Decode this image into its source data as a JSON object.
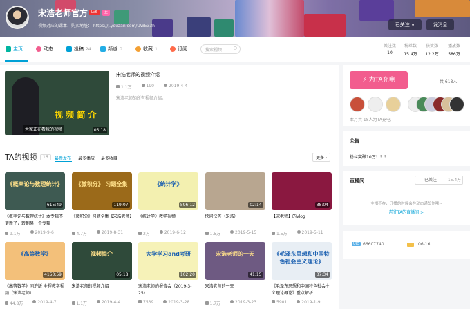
{
  "header": {
    "username": "宋浩老师官方",
    "level": "LV6",
    "badge": "年",
    "sign": "视频对应的课本、购买地址： https://j.youzan.com/UWE33h",
    "follow_btn": "已关注",
    "message_btn": "发消息"
  },
  "nav": {
    "items": [
      {
        "label": "主页",
        "count": ""
      },
      {
        "label": "动态",
        "count": ""
      },
      {
        "label": "投稿",
        "count": "24"
      },
      {
        "label": "频道",
        "count": "0"
      },
      {
        "label": "收藏",
        "count": "1"
      },
      {
        "label": "订阅",
        "count": ""
      }
    ],
    "search_placeholder": "搜索视频"
  },
  "stats": [
    {
      "label": "关注数",
      "value": "10"
    },
    {
      "label": "粉丝数",
      "value": "15.4万"
    },
    {
      "label": "获赞数",
      "value": "12.2万"
    },
    {
      "label": "播放数",
      "value": "586万"
    }
  ],
  "featured": {
    "title": "宋浩老师的视频介绍",
    "plays": "1.1万",
    "danmaku": "190",
    "date": "2019-4-4",
    "desc": "宋浩老师的所有视频介绍。",
    "duration": "05:18",
    "thumb_caption": "大家正在看我的视频",
    "thumb_text": "视 频 简 介"
  },
  "videos_section": {
    "title": "TA的视频",
    "count": "16",
    "tabs": [
      "最新发布",
      "最多播放",
      "最多收藏"
    ],
    "more": "更多"
  },
  "videos": [
    {
      "title": "《概率论与数理统计》本专辑不更新了，转到另一个专辑",
      "duration": "615:49",
      "plays": "9.1万",
      "date": "2019-9-6",
      "thumb": "《概率论与数理统计》",
      "bg": "#3e5a52"
    },
    {
      "title": "《微积分》习题全集【宋浩老师】",
      "duration": "119:07",
      "plays": "4.7万",
      "date": "2019-8-31",
      "thumb": "《微积分》 习题全集",
      "bg": "#9b6a1a"
    },
    {
      "title": "《统计学》教学视频",
      "duration": "596:12",
      "plays": "2万",
      "date": "2019-6-12",
      "thumb": "《统计学》",
      "bg": "#f3f0b0"
    },
    {
      "title": "快问快答（宋浩）",
      "duration": "02:14",
      "plays": "1.5万",
      "date": "2019-5-15",
      "thumb": "",
      "bg": "#b8a690"
    },
    {
      "title": "【宋老师】的vlog",
      "duration": "38:04",
      "plays": "1.5万",
      "date": "2019-5-11",
      "thumb": "",
      "bg": "#8a1840"
    },
    {
      "title": "《高等数学》同济版 全程教学视频（宋浩老师）",
      "duration": "4150:59",
      "plays": "44.8万",
      "date": "2019-4-7",
      "thumb": "《高等数学》",
      "bg": "#f3c07a"
    },
    {
      "title": "宋浩老师的视频介绍",
      "duration": "05:18",
      "plays": "1.1万",
      "date": "2019-4-4",
      "thumb": "视频简介",
      "bg": "#2f4a3a"
    },
    {
      "title": "宋浩老师的报告会（2019-3-25）",
      "duration": "102:20",
      "plays": "7539",
      "date": "2019-3-28",
      "thumb": "大学学习and考研",
      "bg": "#f6f2b8"
    },
    {
      "title": "宋浩老师的一天",
      "duration": "41:15",
      "plays": "1.7万",
      "date": "2019-3-23",
      "thumb": "宋浩老师的一天",
      "bg": "#6e5a82"
    },
    {
      "title": "《毛泽东思想和中国特色社会主义理论概论》重点解析",
      "duration": "37:34",
      "plays": "5901",
      "date": "2019-1-9",
      "thumb": "《毛泽东思想和中国特色社会主义理论》",
      "bg": "#e8eef4"
    }
  ],
  "charge": {
    "button": "为TA充电",
    "total": "共 618人",
    "month": "本月共 18人为TA充电"
  },
  "notice": {
    "title": "公告",
    "text": "粉丝突破10万！！！"
  },
  "live": {
    "title": "直播间",
    "follow": "已关注",
    "fans": "15.4万",
    "offline": "主播不在，开播的时候会在动态通知你哦~",
    "link": "前往TA的直播间 >"
  },
  "info": {
    "uid_label": "UID",
    "uid": "66607740",
    "birthday": "06-16"
  },
  "colors": {
    "accent": "#00a1d6",
    "pink": "#f25d8e"
  }
}
